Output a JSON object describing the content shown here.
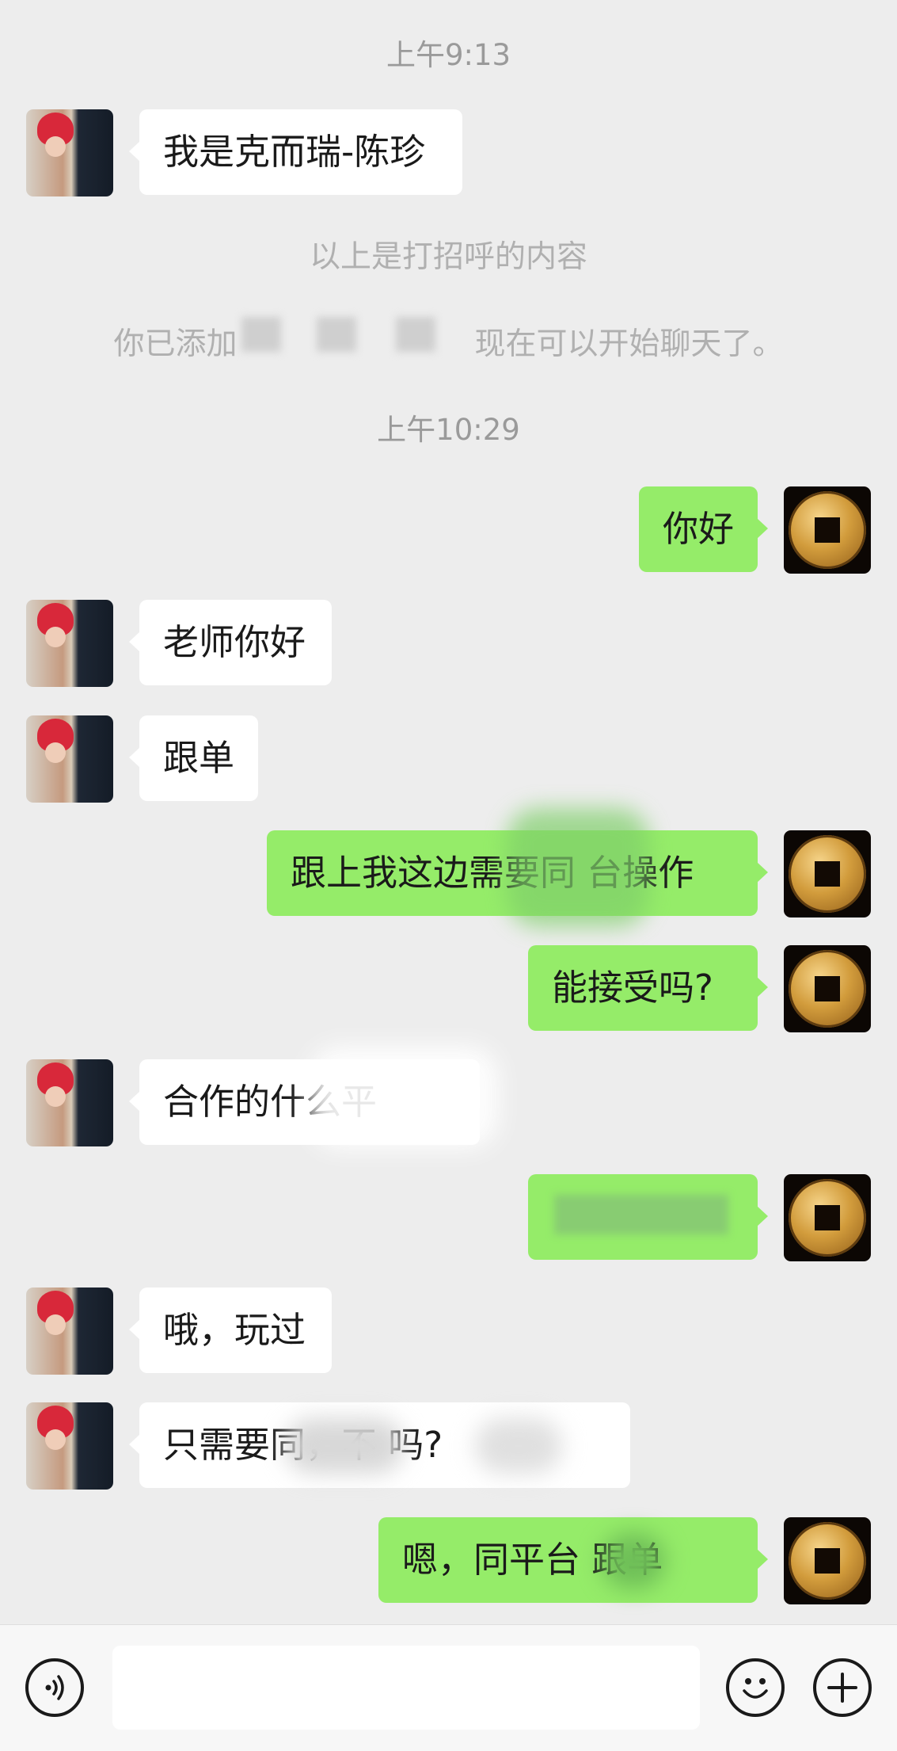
{
  "timestamps": [
    "上午9:13",
    "上午10:29"
  ],
  "system_messages": {
    "greeting_note": "以上是打招呼的内容",
    "added_prefix": "你已添加",
    "added_suffix": "现在可以开始聊天了。"
  },
  "messages": [
    {
      "side": "left",
      "text": "我是克而瑞-陈珍"
    },
    {
      "side": "right",
      "text": "你好"
    },
    {
      "side": "left",
      "text": "老师你好"
    },
    {
      "side": "left",
      "text": "跟单"
    },
    {
      "side": "right",
      "text": "跟上我这边需要同  台操作"
    },
    {
      "side": "right",
      "text": "能接受吗?"
    },
    {
      "side": "left",
      "text": "合作的什么平"
    },
    {
      "side": "right",
      "text": ""
    },
    {
      "side": "left",
      "text": "哦，玩过"
    },
    {
      "side": "left",
      "text": "只需要同，不  吗?"
    },
    {
      "side": "right",
      "text": "嗯，同平台  跟单"
    }
  ],
  "input_bar": {
    "voice_icon": "voice-icon",
    "emoji_icon": "emoji-icon",
    "plus_icon": "plus-icon",
    "message_value": ""
  },
  "colors": {
    "background": "#ededed",
    "bubble_self": "#95ec69",
    "bubble_other": "#ffffff",
    "timestamp_text": "#9a9a9a"
  }
}
